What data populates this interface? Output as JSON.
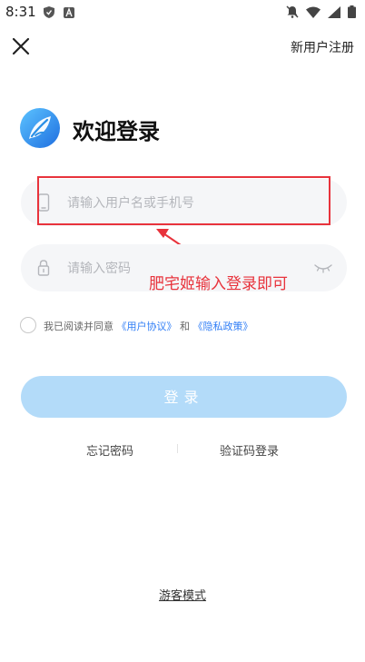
{
  "status_bar": {
    "time": "8:31",
    "left_icons": [
      "shield-icon",
      "a-icon"
    ],
    "right_icons": [
      "mute-icon",
      "wifi-icon",
      "signal-icon",
      "battery-icon"
    ]
  },
  "header": {
    "close_icon": "close-icon",
    "register_label": "新用户注册"
  },
  "brand": {
    "title": "欢迎登录",
    "logo_color": "#2a8fe6"
  },
  "form": {
    "username_placeholder": "请输入用户名或手机号",
    "password_placeholder": "请输入密码",
    "username_icon": "phone-icon",
    "password_icon": "lock-icon",
    "password_toggle_icon": "eye-closed-icon"
  },
  "annotation": {
    "text": "肥宅姬输入登录即可",
    "color": "#e8333c"
  },
  "agreement": {
    "prefix": "我已阅读并同意",
    "user_agreement": "《用户协议》",
    "conjunction": "和",
    "privacy_policy": "《隐私政策》",
    "link_color": "#2f7df6"
  },
  "login_button": {
    "label": "登录",
    "color": "#b3dbf9"
  },
  "links": {
    "forgot_password": "忘记密码",
    "sms_login": "验证码登录",
    "guest_mode": "游客模式"
  }
}
